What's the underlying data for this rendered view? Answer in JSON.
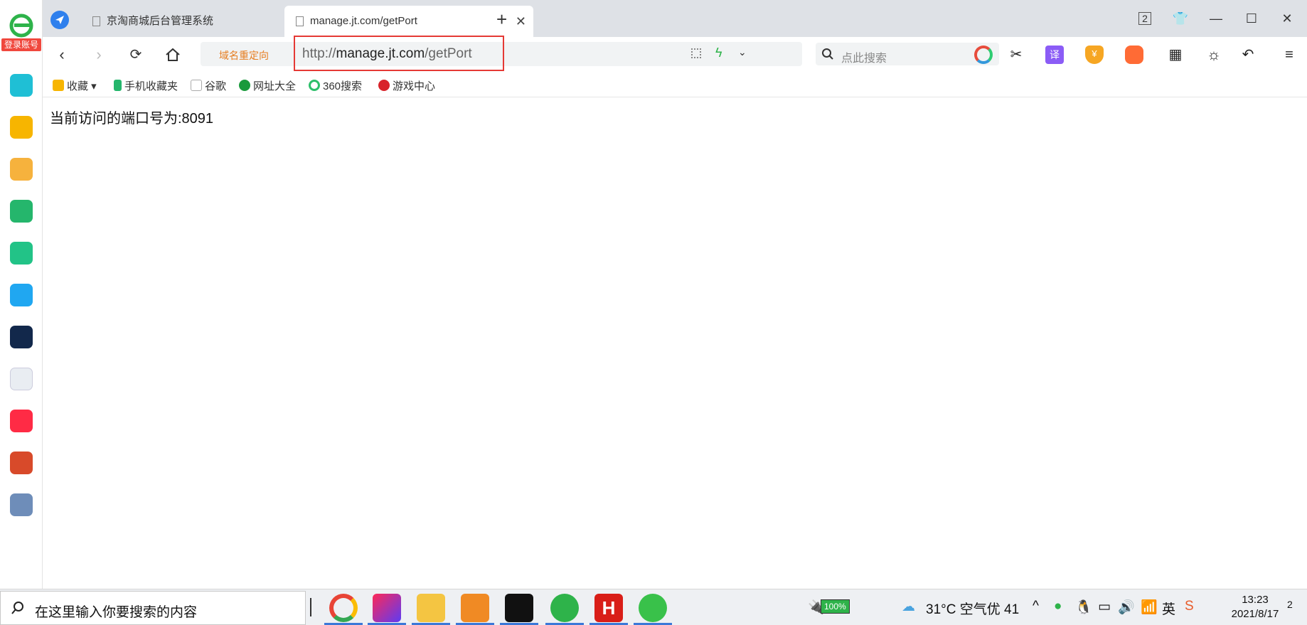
{
  "sidebar": {
    "login_label": "登录账号",
    "apps": [
      "plus-app",
      "favorites-app",
      "weibo-app",
      "mail-app",
      "cloud-app",
      "pdf-app",
      "news-app",
      "wps-app",
      "xiaohongshu-app",
      "game-app",
      "game2-app"
    ],
    "app_colors": [
      "#1fbfd5",
      "#f7b500",
      "#f6b23d",
      "#25b66c",
      "#22c387",
      "#20a7f1",
      "#12284b",
      "#e9edf2",
      "#ff2b45",
      "#d84a2a",
      "#6e8db9"
    ]
  },
  "tabs": [
    {
      "title": "京淘商城后台管理系统",
      "active": false
    },
    {
      "title": "manage.jt.com/getPort",
      "active": true
    }
  ],
  "window": {
    "tab_count_badge": "2"
  },
  "toolbar": {
    "redirect_label": "域名重定向",
    "url_scheme": "http://",
    "url_host": "manage.jt.com",
    "url_path": "/getPort",
    "search_placeholder": "点此搜索"
  },
  "bookmarks": [
    {
      "label": "收藏",
      "icon": "star-icon",
      "color": "#f7b500"
    },
    {
      "label": "手机收藏夹",
      "icon": "phone-icon",
      "color": "#25b66c"
    },
    {
      "label": "谷歌",
      "icon": "page-icon",
      "color": "#bbbbbb"
    },
    {
      "label": "网址大全",
      "icon": "globe-icon",
      "color": "#1a9a3c"
    },
    {
      "label": "360搜索",
      "icon": "search360-icon",
      "color": "#2dbf6a"
    },
    {
      "label": "游戏中心",
      "icon": "game-icon",
      "color": "#d8232a"
    }
  ],
  "content": {
    "text": "当前访问的端口号为:8091"
  },
  "taskbar": {
    "search_placeholder": "在这里输入你要搜索的内容",
    "battery": "100%",
    "weather": "31°C  空气优 41",
    "time": "13:23",
    "date": "2021/8/17",
    "notification_count": "2"
  },
  "colors": {
    "accent": "#e53935",
    "tab_strip": "#dee1e6",
    "redirect": "#e67e22"
  }
}
